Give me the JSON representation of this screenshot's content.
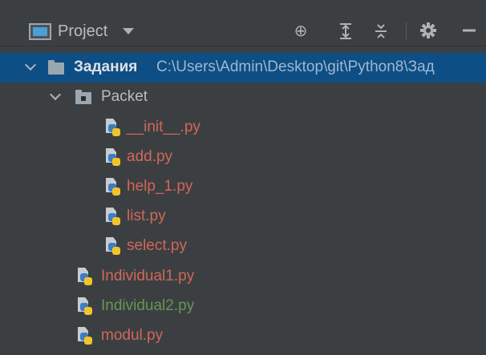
{
  "toolbar": {
    "title": "Project",
    "icons": [
      "project-view-icon",
      "chevron-down-icon",
      "locate-icon",
      "expand-all-icon",
      "collapse-all-icon",
      "gear-icon",
      "minimize-icon"
    ],
    "buttons": {
      "locate": "⊕",
      "expand": "⩦",
      "collapse": "∓",
      "settings": "✱",
      "hide": "—"
    }
  },
  "tree": {
    "root": {
      "name": "Задания",
      "path": "C:\\Users\\Admin\\Desktop\\git\\Python8\\Зад"
    },
    "packet": {
      "name": "Packet"
    },
    "packet_files": [
      {
        "name": "__init__.py"
      },
      {
        "name": "add.py"
      },
      {
        "name": "help_1.py"
      },
      {
        "name": "list.py"
      },
      {
        "name": "select.py"
      }
    ],
    "root_files": [
      {
        "name": "Individual1.py"
      },
      {
        "name": "Individual2.py"
      },
      {
        "name": "modul.py"
      }
    ]
  },
  "colors": {
    "background": "#3c3f41",
    "selection": "#0d4e85",
    "modified_file": "#d1675a",
    "added_file": "#629755"
  }
}
